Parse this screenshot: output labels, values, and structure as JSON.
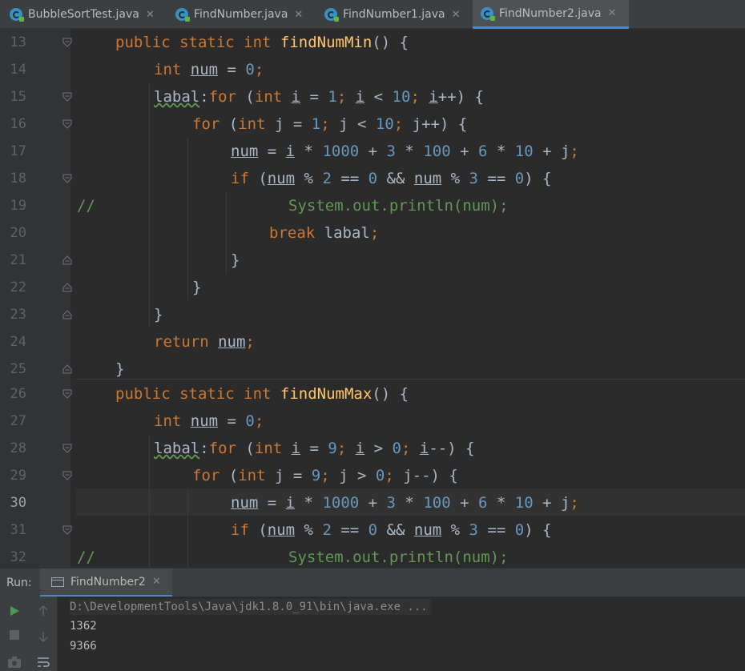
{
  "tabs": [
    {
      "label": "BubbleSortTest.java",
      "active": false
    },
    {
      "label": "FindNumber.java",
      "active": false
    },
    {
      "label": "FindNumber1.java",
      "active": false
    },
    {
      "label": "FindNumber2.java",
      "active": true
    }
  ],
  "editor": {
    "current_line": "30",
    "lines": [
      {
        "n": "13"
      },
      {
        "n": "14"
      },
      {
        "n": "15"
      },
      {
        "n": "16"
      },
      {
        "n": "17"
      },
      {
        "n": "18"
      },
      {
        "n": "19"
      },
      {
        "n": "20"
      },
      {
        "n": "21"
      },
      {
        "n": "22"
      },
      {
        "n": "23"
      },
      {
        "n": "24"
      },
      {
        "n": "25"
      },
      {
        "n": "26"
      },
      {
        "n": "27"
      },
      {
        "n": "28"
      },
      {
        "n": "29"
      },
      {
        "n": "30"
      },
      {
        "n": "31"
      },
      {
        "n": "32"
      }
    ],
    "code": {
      "l13": {
        "kw": "public static int ",
        "fn": "findNumMin",
        "rest": "() {"
      },
      "l14": {
        "kw": "int ",
        "v": "num",
        "eq": " = ",
        "n": "0",
        "semi": ";"
      },
      "l15": {
        "label": "labal",
        "colon": ":",
        "kw": "for",
        "p1": " (",
        "kw2": "int ",
        "v": "i",
        "eq": " = ",
        "n1": "1",
        "semi1": "; ",
        "v2": "i",
        "lt": " < ",
        "n2": "10",
        "semi2": "; ",
        "v3": "i",
        "inc": "++) {"
      },
      "l16": {
        "kw": "for",
        "p1": " (",
        "kw2": "int ",
        "v": "j",
        "eq": " = ",
        "n1": "1",
        "semi1": "; ",
        "v2": "j",
        "lt": " < ",
        "n2": "10",
        "semi2": "; ",
        "inc": "j++) {"
      },
      "l17": {
        "v": "num",
        "eq": " = ",
        "v2": "i",
        "m1": " * ",
        "n1": "1000",
        "p1": " + ",
        "n2": "3",
        "m2": " * ",
        "n3": "100",
        "p2": " + ",
        "n4": "6",
        "m3": " * ",
        "n5": "10",
        "p3": " + j",
        "semi": ";"
      },
      "l18": {
        "kw": "if",
        "p1": " (",
        "v": "num",
        "mod": " % ",
        "n1": "2",
        "eqeq": " == ",
        "n2": "0",
        "and": " && ",
        "v2": "num",
        "mod2": " % ",
        "n3": "3",
        "eqeq2": " == ",
        "n4": "0",
        "end": ") {"
      },
      "l19": {
        "cm": "//",
        "body": "System.out.println(num);"
      },
      "l20": {
        "kw": "break ",
        "label": "labal",
        "semi": ";"
      },
      "l21": {
        "t": "}"
      },
      "l22": {
        "t": "}"
      },
      "l23": {
        "t": "}"
      },
      "l24": {
        "kw": "return ",
        "v": "num",
        "semi": ";"
      },
      "l25": {
        "t": "}"
      },
      "l26": {
        "kw": "public static int ",
        "fn": "findNumMax",
        "rest": "() {"
      },
      "l27": {
        "kw": "int ",
        "v": "num",
        "eq": " = ",
        "n": "0",
        "semi": ";"
      },
      "l28": {
        "label": "labal",
        "colon": ":",
        "kw": "for",
        "p1": " (",
        "kw2": "int ",
        "v": "i",
        "eq": " = ",
        "n1": "9",
        "semi1": "; ",
        "v2": "i",
        "gt": " > ",
        "n2": "0",
        "semi2": "; ",
        "v3": "i",
        "dec": "--) {"
      },
      "l29": {
        "kw": "for",
        "p1": " (",
        "kw2": "int ",
        "v": "j",
        "eq": " = ",
        "n1": "9",
        "semi1": "; ",
        "v2": "j",
        "gt": " > ",
        "n2": "0",
        "semi2": "; ",
        "dec": "j--) {"
      },
      "l30": {
        "v": "num",
        "eq": " = ",
        "v2": "i",
        "m1": " * ",
        "n1": "1000",
        "p1": " + ",
        "n2": "3",
        "m2": " * ",
        "n3": "100",
        "p2": " + ",
        "n4": "6",
        "m3": " * ",
        "n5": "10",
        "p3": " + j",
        "semi": ";"
      },
      "l31": {
        "kw": "if",
        "p1": " (",
        "v": "num",
        "mod": " % ",
        "n1": "2",
        "eqeq": " == ",
        "n2": "0",
        "and": " && ",
        "v2": "num",
        "mod2": " % ",
        "n3": "3",
        "eqeq2": " == ",
        "n4": "0",
        "end": ") {"
      },
      "l32": {
        "cm": "//",
        "body": "System.out.println(num);"
      }
    }
  },
  "run": {
    "label": "Run:",
    "tab_label": "FindNumber2",
    "command": "D:\\DevelopmentTools\\Java\\jdk1.8.0_91\\bin\\java.exe ...",
    "output": [
      "1362",
      "9366"
    ]
  },
  "colors": {
    "keyword": "#cc7832",
    "function": "#ffc66d",
    "number": "#6897bb",
    "comment": "#629755",
    "text": "#a9b7c6",
    "accent": "#4a88c7",
    "run_green": "#499c54"
  },
  "icons": [
    "java-class-icon",
    "close-icon",
    "fold-icon",
    "run-icon",
    "stop-icon",
    "camera-icon",
    "up-arrow-icon",
    "down-arrow-icon",
    "soft-wrap-icon",
    "console-icon"
  ]
}
